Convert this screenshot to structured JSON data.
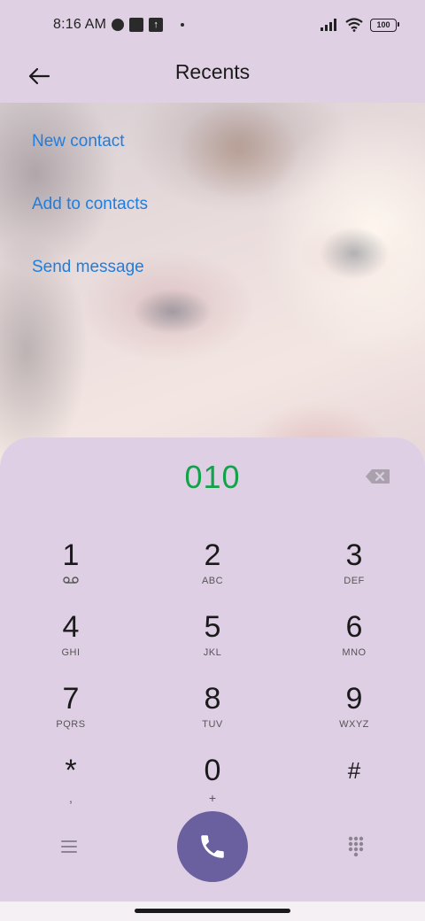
{
  "status_bar": {
    "time": "8:16 AM",
    "battery": "100",
    "icons": [
      "app-circle-icon",
      "app-square-icon",
      "upload-icon",
      "dot-icon",
      "signal-icon",
      "wifi-icon",
      "battery-icon"
    ]
  },
  "header": {
    "title": "Recents",
    "back_icon": "back-arrow-icon"
  },
  "actions": [
    {
      "label": "New contact"
    },
    {
      "label": "Add to contacts"
    },
    {
      "label": "Send message"
    }
  ],
  "dialer": {
    "number": "010",
    "number_color": "#12a34a",
    "keys": [
      {
        "digit": "1",
        "letters": "",
        "icon": "voicemail-icon"
      },
      {
        "digit": "2",
        "letters": "ABC"
      },
      {
        "digit": "3",
        "letters": "DEF"
      },
      {
        "digit": "4",
        "letters": "GHI"
      },
      {
        "digit": "5",
        "letters": "JKL"
      },
      {
        "digit": "6",
        "letters": "MNO"
      },
      {
        "digit": "7",
        "letters": "PQRS"
      },
      {
        "digit": "8",
        "letters": "TUV"
      },
      {
        "digit": "9",
        "letters": "WXYZ"
      },
      {
        "digit": "*",
        "letters": ","
      },
      {
        "digit": "0",
        "letters": "+"
      },
      {
        "digit": "#",
        "letters": ""
      }
    ]
  },
  "colors": {
    "accent_link": "#1e7ee0",
    "call_button": "#6a5f9f",
    "sheet_background": "#decfe4"
  }
}
